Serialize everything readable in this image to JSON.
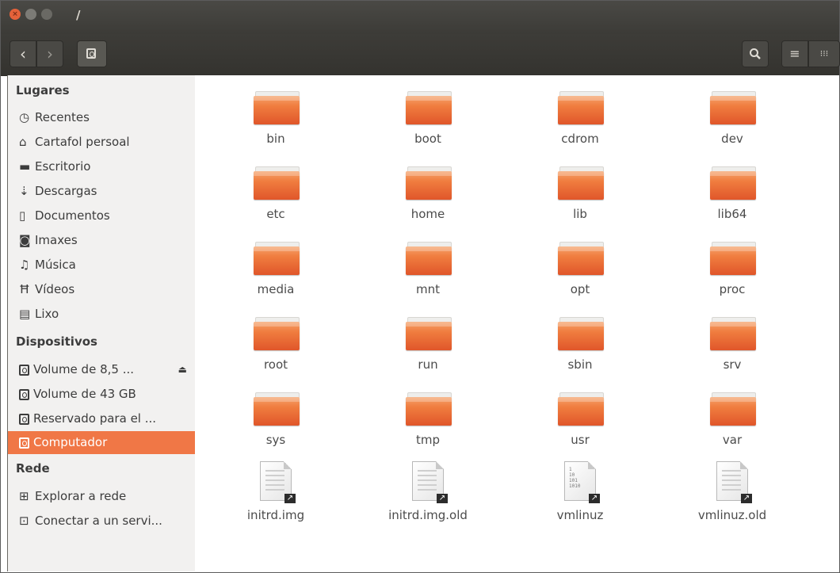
{
  "window": {
    "title": "/"
  },
  "toolbar": {
    "back_icon": "chevron-left-icon",
    "forward_icon": "chevron-right-icon",
    "path_icon": "drive-icon",
    "search_icon": "search-icon",
    "list_view_icon": "list-view-icon",
    "grid_view_icon": "grid-view-icon"
  },
  "sidebar": {
    "places_heading": "Lugares",
    "places": [
      {
        "label": "Recentes",
        "icon": "clock-icon"
      },
      {
        "label": "Cartafol persoal",
        "icon": "home-icon"
      },
      {
        "label": "Escritorio",
        "icon": "desktop-folder-icon"
      },
      {
        "label": "Descargas",
        "icon": "download-icon"
      },
      {
        "label": "Documentos",
        "icon": "document-icon"
      },
      {
        "label": "Imaxes",
        "icon": "camera-icon"
      },
      {
        "label": "Música",
        "icon": "music-icon"
      },
      {
        "label": "Vídeos",
        "icon": "film-icon"
      },
      {
        "label": "Lixo",
        "icon": "trash-icon"
      }
    ],
    "devices_heading": "Dispositivos",
    "devices": [
      {
        "label": "Volume de 8,5 ...",
        "icon": "drive-icon",
        "eject": true
      },
      {
        "label": "Volume de 43 GB",
        "icon": "drive-icon"
      },
      {
        "label": "Reservado para el ...",
        "icon": "drive-icon"
      },
      {
        "label": "Computador",
        "icon": "drive-icon",
        "active": true
      }
    ],
    "network_heading": "Rede",
    "network": [
      {
        "label": "Explorar a rede",
        "icon": "network-icon"
      },
      {
        "label": "Conectar a un servi...",
        "icon": "server-icon"
      }
    ]
  },
  "files": [
    {
      "name": "bin",
      "kind": "folder"
    },
    {
      "name": "boot",
      "kind": "folder"
    },
    {
      "name": "cdrom",
      "kind": "folder"
    },
    {
      "name": "dev",
      "kind": "folder"
    },
    {
      "name": "etc",
      "kind": "folder"
    },
    {
      "name": "home",
      "kind": "folder"
    },
    {
      "name": "lib",
      "kind": "folder"
    },
    {
      "name": "lib64",
      "kind": "folder"
    },
    {
      "name": "media",
      "kind": "folder"
    },
    {
      "name": "mnt",
      "kind": "folder"
    },
    {
      "name": "opt",
      "kind": "folder"
    },
    {
      "name": "proc",
      "kind": "folder"
    },
    {
      "name": "root",
      "kind": "folder"
    },
    {
      "name": "run",
      "kind": "folder"
    },
    {
      "name": "sbin",
      "kind": "folder"
    },
    {
      "name": "srv",
      "kind": "folder"
    },
    {
      "name": "sys",
      "kind": "folder"
    },
    {
      "name": "tmp",
      "kind": "folder"
    },
    {
      "name": "usr",
      "kind": "folder"
    },
    {
      "name": "var",
      "kind": "folder"
    },
    {
      "name": "initrd.img",
      "kind": "link-file"
    },
    {
      "name": "initrd.img.old",
      "kind": "link-file"
    },
    {
      "name": "vmlinuz",
      "kind": "link-binary"
    },
    {
      "name": "vmlinuz.old",
      "kind": "link-file"
    }
  ],
  "colors": {
    "accent": "#f07746",
    "titlebar": "#3c3b37",
    "sidebar": "#f2f1f0",
    "folder": "#f07d3f"
  }
}
